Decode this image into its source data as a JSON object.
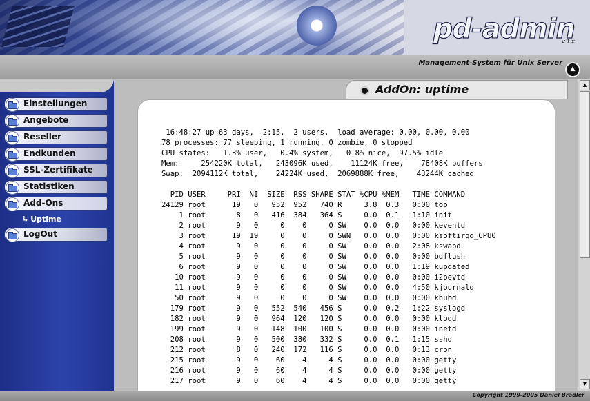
{
  "header": {
    "logo_text": "pd-admin",
    "logo_version": "v3.x"
  },
  "subheader": {
    "tagline": "Management-System für Unix Server"
  },
  "sidebar": {
    "items": [
      {
        "label": "Einstellungen"
      },
      {
        "label": "Angebote"
      },
      {
        "label": "Reseller"
      },
      {
        "label": "Endkunden"
      },
      {
        "label": "SSL-Zertifikate"
      },
      {
        "label": "Statistiken"
      },
      {
        "label": "Add-Ons"
      },
      {
        "label": "LogOut"
      }
    ],
    "subitem": {
      "label": "Uptime"
    }
  },
  "content": {
    "title": "AddOn: uptime",
    "output": " 16:48:27 up 63 days,  2:15,  2 users,  load average: 0.00, 0.00, 0.00\n78 processes: 77 sleeping, 1 running, 0 zombie, 0 stopped\nCPU states:   1.3% user,   0.4% system,   0.8% nice,  97.5% idle\nMem:     254220K total,   243096K used,    11124K free,    78408K buffers\nSwap:  2094112K total,    24224K used,  2069888K free,    43244K cached\n\n  PID USER     PRI  NI  SIZE  RSS SHARE STAT %CPU %MEM   TIME COMMAND\n24129 root      19   0   952  952   740 R     3.8  0.3   0:00 top\n    1 root       8   0   416  384   364 S     0.0  0.1   1:10 init\n    2 root       9   0     0    0     0 SW    0.0  0.0   0:00 keventd\n    3 root      19  19     0    0     0 SWN   0.0  0.0   0:00 ksoftirqd_CPU0\n    4 root       9   0     0    0     0 SW    0.0  0.0   2:08 kswapd\n    5 root       9   0     0    0     0 SW    0.0  0.0   0:00 bdflush\n    6 root       9   0     0    0     0 SW    0.0  0.0   1:19 kupdated\n   10 root       9   0     0    0     0 SW    0.0  0.0   0:00 i2oevtd\n   11 root       9   0     0    0     0 SW    0.0  0.0   4:50 kjournald\n   50 root       9   0     0    0     0 SW    0.0  0.0   0:00 khubd\n  179 root       9   0   552  540   456 S     0.0  0.2   1:22 syslogd\n  182 root       9   0   964  120   120 S     0.0  0.0   0:00 klogd\n  199 root       9   0   148  100   100 S     0.0  0.0   0:00 inetd\n  208 root       9   0   500  380   332 S     0.0  0.1   1:15 sshd\n  212 root       8   0   240  172   116 S     0.0  0.0   0:13 cron\n  215 root       9   0    60    4     4 S     0.0  0.0   0:00 getty\n  216 root       9   0    60    4     4 S     0.0  0.0   0:00 getty\n  217 root       9   0    60    4     4 S     0.0  0.0   0:00 getty"
  },
  "footer": {
    "copyright": "Copyright 1999-2005 Daniel Bradler"
  }
}
